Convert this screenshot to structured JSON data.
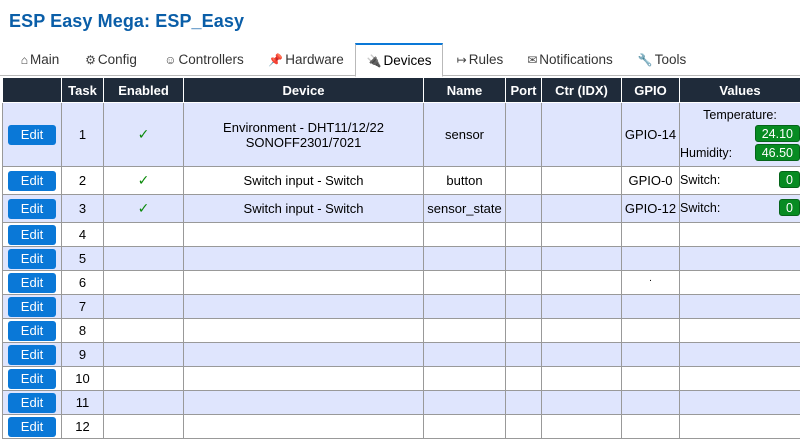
{
  "app": {
    "title": "ESP Easy Mega: ESP_Easy"
  },
  "nav": {
    "tabs": [
      {
        "label": "Main",
        "icon": "⌂",
        "icon_name": "home-icon"
      },
      {
        "label": "Config",
        "icon": "⚙",
        "icon_name": "gear-icon"
      },
      {
        "label": "Controllers",
        "icon": "☺",
        "icon_name": "chat-icon"
      },
      {
        "label": "Hardware",
        "icon": "📌",
        "icon_name": "pin-icon"
      },
      {
        "label": "Devices",
        "icon": "🔌",
        "icon_name": "plug-icon",
        "active": true
      },
      {
        "label": "Rules",
        "icon": "↦",
        "icon_name": "rules-arrow-icon"
      },
      {
        "label": "Notifications",
        "icon": "✉",
        "icon_name": "mail-icon"
      },
      {
        "label": "Tools",
        "icon": "🔧",
        "icon_name": "wrench-icon"
      }
    ]
  },
  "table": {
    "headers": [
      "",
      "Task",
      "Enabled",
      "Device",
      "Name",
      "Port",
      "Ctr (IDX)",
      "GPIO",
      "Values"
    ],
    "edit_label": "Edit",
    "rows": [
      {
        "task": "1",
        "enabled": "✓",
        "device": "Environment - DHT11/12/22",
        "device2": "SONOFF2301/7021",
        "name": "sensor",
        "port": "",
        "ctr": "",
        "gpio": "GPIO-14",
        "values": [
          {
            "label": "Temperature:",
            "value": "24.10"
          },
          {
            "label": "Humidity:",
            "value": "46.50"
          }
        ]
      },
      {
        "task": "2",
        "enabled": "✓",
        "device": "Switch input - Switch",
        "name": "button",
        "port": "",
        "ctr": "",
        "gpio": "GPIO-0",
        "values": [
          {
            "label": "Switch:",
            "value": "0"
          }
        ]
      },
      {
        "task": "3",
        "enabled": "✓",
        "device": "Switch input - Switch",
        "name": "sensor_state",
        "port": "",
        "ctr": "",
        "gpio": "GPIO-12",
        "values": [
          {
            "label": "Switch:",
            "value": "0"
          }
        ]
      },
      {
        "task": "4",
        "enabled": "",
        "device": "",
        "name": "",
        "port": "",
        "ctr": "",
        "gpio": "",
        "values": []
      },
      {
        "task": "5",
        "enabled": "",
        "device": "",
        "name": "",
        "port": "",
        "ctr": "",
        "gpio": "",
        "values": []
      },
      {
        "task": "6",
        "enabled": "",
        "device": "",
        "name": "",
        "port": "",
        "ctr": "",
        "gpio": "·",
        "values": []
      },
      {
        "task": "7",
        "enabled": "",
        "device": "",
        "name": "",
        "port": "",
        "ctr": "",
        "gpio": "",
        "values": []
      },
      {
        "task": "8",
        "enabled": "",
        "device": "",
        "name": "",
        "port": "",
        "ctr": "",
        "gpio": "",
        "values": []
      },
      {
        "task": "9",
        "enabled": "",
        "device": "",
        "name": "",
        "port": "",
        "ctr": "",
        "gpio": "",
        "values": []
      },
      {
        "task": "10",
        "enabled": "",
        "device": "",
        "name": "",
        "port": "",
        "ctr": "",
        "gpio": "",
        "values": []
      },
      {
        "task": "11",
        "enabled": "",
        "device": "",
        "name": "",
        "port": "",
        "ctr": "",
        "gpio": "",
        "values": []
      },
      {
        "task": "12",
        "enabled": "",
        "device": "",
        "name": "",
        "port": "",
        "ctr": "",
        "gpio": "",
        "values": []
      }
    ]
  },
  "colors": {
    "title": "#0a5ea8",
    "header_bg": "#1f2b3a",
    "row_alt": "#dfe5fd",
    "button": "#0a78d7",
    "value_badge": "#078b22",
    "check": "#0b8a0b"
  }
}
